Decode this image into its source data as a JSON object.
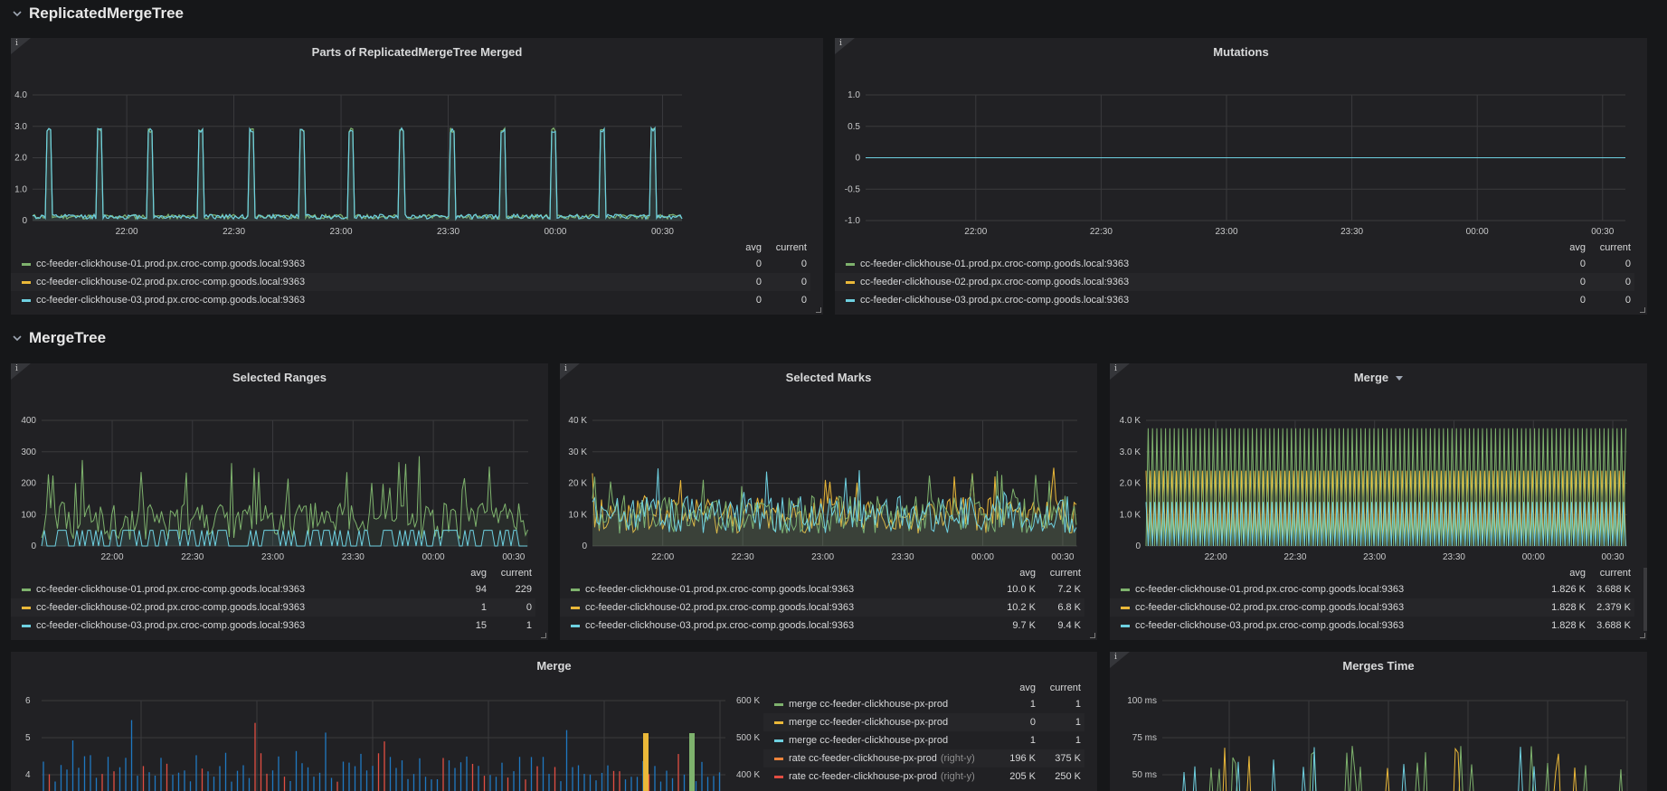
{
  "rows": {
    "replicated": {
      "title": "ReplicatedMergeTree"
    },
    "mergetree": {
      "title": "MergeTree"
    }
  },
  "legend_headers": {
    "avg": "avg",
    "current": "current"
  },
  "colors": {
    "green": "#7eb26d",
    "yellow": "#eab839",
    "cyan": "#6ed0e0",
    "orange": "#ef843c",
    "red": "#e24d42",
    "blue": "#1f78c1"
  },
  "panels": {
    "parts_merged": {
      "title": "Parts of ReplicatedMergeTree Merged",
      "yticks": [
        "4.0",
        "3.0",
        "2.0",
        "1.0",
        "0"
      ],
      "xticks": [
        "22:00",
        "22:30",
        "23:00",
        "23:30",
        "00:00",
        "00:30"
      ],
      "legend": [
        {
          "name": "cc-feeder-clickhouse-01.prod.px.croc-comp.goods.local:9363",
          "color": "green",
          "avg": "0",
          "current": "0"
        },
        {
          "name": "cc-feeder-clickhouse-02.prod.px.croc-comp.goods.local:9363",
          "color": "yellow",
          "avg": "0",
          "current": "0"
        },
        {
          "name": "cc-feeder-clickhouse-03.prod.px.croc-comp.goods.local:9363",
          "color": "cyan",
          "avg": "0",
          "current": "0"
        }
      ]
    },
    "mutations": {
      "title": "Mutations",
      "yticks": [
        "1.0",
        "0.5",
        "0",
        "-0.5",
        "-1.0"
      ],
      "xticks": [
        "22:00",
        "22:30",
        "23:00",
        "23:30",
        "00:00",
        "00:30"
      ],
      "legend": [
        {
          "name": "cc-feeder-clickhouse-01.prod.px.croc-comp.goods.local:9363",
          "color": "green",
          "avg": "0",
          "current": "0"
        },
        {
          "name": "cc-feeder-clickhouse-02.prod.px.croc-comp.goods.local:9363",
          "color": "yellow",
          "avg": "0",
          "current": "0"
        },
        {
          "name": "cc-feeder-clickhouse-03.prod.px.croc-comp.goods.local:9363",
          "color": "cyan",
          "avg": "0",
          "current": "0"
        }
      ]
    },
    "selected_ranges": {
      "title": "Selected Ranges",
      "yticks": [
        "400",
        "300",
        "200",
        "100",
        "0"
      ],
      "xticks": [
        "22:00",
        "22:30",
        "23:00",
        "23:30",
        "00:00",
        "00:30"
      ],
      "legend": [
        {
          "name": "cc-feeder-clickhouse-01.prod.px.croc-comp.goods.local:9363",
          "color": "green",
          "avg": "94",
          "current": "229"
        },
        {
          "name": "cc-feeder-clickhouse-02.prod.px.croc-comp.goods.local:9363",
          "color": "yellow",
          "avg": "1",
          "current": "0"
        },
        {
          "name": "cc-feeder-clickhouse-03.prod.px.croc-comp.goods.local:9363",
          "color": "cyan",
          "avg": "15",
          "current": "1"
        }
      ]
    },
    "selected_marks": {
      "title": "Selected Marks",
      "yticks": [
        "40 K",
        "30 K",
        "20 K",
        "10 K",
        "0"
      ],
      "xticks": [
        "22:00",
        "22:30",
        "23:00",
        "23:30",
        "00:00",
        "00:30"
      ],
      "legend": [
        {
          "name": "cc-feeder-clickhouse-01.prod.px.croc-comp.goods.local:9363",
          "color": "green",
          "avg": "10.0 K",
          "current": "7.2 K"
        },
        {
          "name": "cc-feeder-clickhouse-02.prod.px.croc-comp.goods.local:9363",
          "color": "yellow",
          "avg": "10.2 K",
          "current": "6.8 K"
        },
        {
          "name": "cc-feeder-clickhouse-03.prod.px.croc-comp.goods.local:9363",
          "color": "cyan",
          "avg": "9.7 K",
          "current": "9.4 K"
        }
      ]
    },
    "merge_top": {
      "title": "Merge",
      "yticks": [
        "4.0 K",
        "3.0 K",
        "2.0 K",
        "1.0 K",
        "0"
      ],
      "xticks": [
        "22:00",
        "22:30",
        "23:00",
        "23:30",
        "00:00",
        "00:30"
      ],
      "legend": [
        {
          "name": "cc-feeder-clickhouse-01.prod.px.croc-comp.goods.local:9363",
          "color": "green",
          "avg": "1.826 K",
          "current": "3.688 K"
        },
        {
          "name": "cc-feeder-clickhouse-02.prod.px.croc-comp.goods.local:9363",
          "color": "yellow",
          "avg": "1.828 K",
          "current": "2.379 K"
        },
        {
          "name": "cc-feeder-clickhouse-03.prod.px.croc-comp.goods.local:9363",
          "color": "cyan",
          "avg": "1.828 K",
          "current": "3.688 K"
        }
      ]
    },
    "merge_bottom": {
      "title": "Merge",
      "yticks_left": [
        "6",
        "5",
        "4"
      ],
      "yticks_right": [
        "600 K",
        "500 K",
        "400 K"
      ],
      "legend": [
        {
          "name": "merge cc-feeder-clickhouse-px-prod",
          "color": "green",
          "axis": "",
          "avg": "1",
          "current": "1"
        },
        {
          "name": "merge cc-feeder-clickhouse-px-prod",
          "color": "yellow",
          "axis": "",
          "avg": "0",
          "current": "1"
        },
        {
          "name": "merge cc-feeder-clickhouse-px-prod",
          "color": "cyan",
          "axis": "",
          "avg": "1",
          "current": "1"
        },
        {
          "name": "rate cc-feeder-clickhouse-px-prod",
          "color": "orange",
          "axis": "(right-y)",
          "avg": "196 K",
          "current": "375 K"
        },
        {
          "name": "rate cc-feeder-clickhouse-px-prod",
          "color": "red",
          "axis": "(right-y)",
          "avg": "205 K",
          "current": "250 K"
        }
      ]
    },
    "merges_time": {
      "title": "Merges Time",
      "yticks": [
        "100 ms",
        "75 ms",
        "50 ms"
      ]
    }
  }
}
